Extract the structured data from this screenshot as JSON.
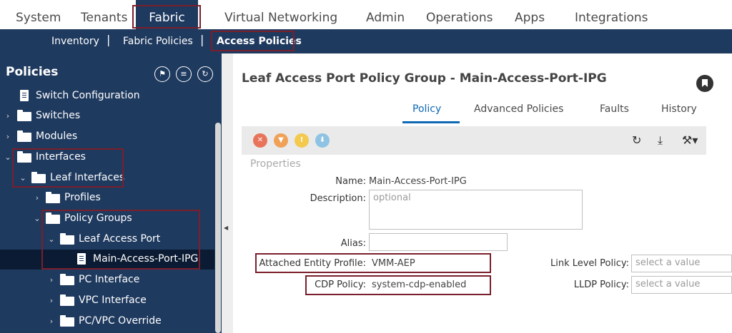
{
  "top_nav": {
    "items": [
      {
        "label": "System"
      },
      {
        "label": "Tenants"
      },
      {
        "label": "Fabric"
      },
      {
        "label": "Virtual Networking"
      },
      {
        "label": "Admin"
      },
      {
        "label": "Operations"
      },
      {
        "label": "Apps"
      },
      {
        "label": "Integrations"
      }
    ],
    "active": "Fabric"
  },
  "sub_nav": {
    "items": [
      {
        "label": "Inventory"
      },
      {
        "label": "Fabric Policies"
      },
      {
        "label": "Access Policies"
      }
    ],
    "separator": "|",
    "active": "Access Policies"
  },
  "sidebar": {
    "title": "Policies",
    "tools": [
      {
        "icon": "flag-icon",
        "glyph": "⚑"
      },
      {
        "icon": "list-icon",
        "glyph": "≡"
      },
      {
        "icon": "refresh-icon",
        "glyph": "↻"
      }
    ],
    "tree": [
      {
        "label": "Switch Configuration",
        "icon": "document-icon"
      },
      {
        "label": "Switches",
        "icon": "folder-icon",
        "expander": "›"
      },
      {
        "label": "Modules",
        "icon": "folder-icon",
        "expander": "›"
      },
      {
        "label": "Interfaces",
        "icon": "folder-icon",
        "expander": "⌄"
      },
      {
        "label": "Leaf Interfaces",
        "icon": "folder-icon",
        "expander": "⌄"
      },
      {
        "label": "Profiles",
        "icon": "folder-icon",
        "expander": "›"
      },
      {
        "label": "Policy Groups",
        "icon": "folder-icon",
        "expander": "⌄"
      },
      {
        "label": "Leaf Access Port",
        "icon": "folder-icon",
        "expander": "⌄"
      },
      {
        "label": "Main-Access-Port-IPG",
        "icon": "document-icon",
        "selected": true
      },
      {
        "label": "PC Interface",
        "icon": "folder-icon",
        "expander": "›"
      },
      {
        "label": "VPC Interface",
        "icon": "folder-icon",
        "expander": "›"
      },
      {
        "label": "PC/VPC Override",
        "icon": "folder-icon",
        "expander": "›"
      }
    ]
  },
  "content": {
    "heading": "Leaf Access Port Policy Group - Main-Access-Port-IPG",
    "tabs": [
      {
        "label": "Policy"
      },
      {
        "label": "Advanced Policies"
      },
      {
        "label": "Faults"
      },
      {
        "label": "History"
      }
    ],
    "active_tab": "Policy",
    "toolbar": {
      "fault_badges": [
        {
          "icon": "critical-fault-icon",
          "color": "#e8735a",
          "glyph": "✕"
        },
        {
          "icon": "major-fault-icon",
          "color": "#f0a158",
          "glyph": "▼"
        },
        {
          "icon": "minor-fault-icon",
          "color": "#f3c94e",
          "glyph": "!"
        },
        {
          "icon": "warning-fault-icon",
          "color": "#8fc3e3",
          "glyph": "⬇"
        }
      ],
      "actions": [
        {
          "icon": "refresh-icon",
          "glyph": "↻"
        },
        {
          "icon": "download-icon",
          "glyph": "⤓"
        },
        {
          "icon": "tools-icon",
          "glyph": "⚒▾"
        }
      ]
    },
    "properties": {
      "title": "Properties",
      "name_label": "Name:",
      "name_value": "Main-Access-Port-IPG",
      "description_label": "Description:",
      "description_placeholder": "optional",
      "alias_label": "Alias:",
      "alias_value": "",
      "aep_label": "Attached Entity Profile:",
      "aep_value": "VMM-AEP",
      "cdp_label": "CDP Policy:",
      "cdp_value": "system-cdp-enabled",
      "link_level_label": "Link Level Policy:",
      "link_level_placeholder": "select a value",
      "lldp_label": "LLDP Policy:",
      "lldp_placeholder": "select a value"
    }
  },
  "colors": {
    "nav_dark": "#1f3a5f",
    "selected_row": "#0b1b33",
    "highlight_box": "#7a1f2b",
    "tab_active": "#0f69b4"
  }
}
